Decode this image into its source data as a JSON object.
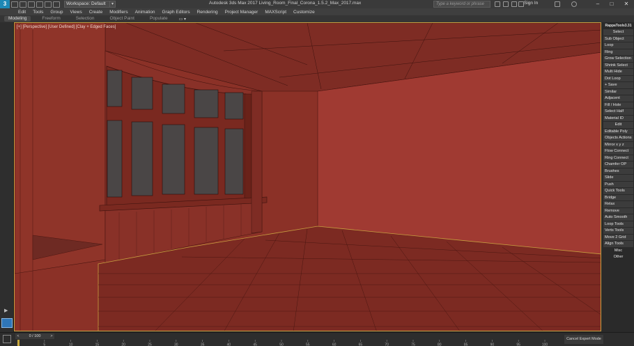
{
  "titlebar": {
    "logo": "3",
    "workspace": "Workspace: Default",
    "title": "Autodesk 3ds Max 2017    Living_Room_Final_Corona_1.5.2_Max_2017.max",
    "search_placeholder": "Type a keyword or phrase",
    "signin": "Sign In",
    "minimize": "–",
    "maximize": "□",
    "close": "✕"
  },
  "menu": [
    "Edit",
    "Tools",
    "Group",
    "Views",
    "Create",
    "Modifiers",
    "Animation",
    "Graph Editors",
    "Rendering",
    "Project Manager",
    "MAXScript",
    "Customize"
  ],
  "ribbon": {
    "tabs": [
      {
        "label": "Modeling",
        "active": true
      },
      {
        "label": "Freeform",
        "active": false
      },
      {
        "label": "Selection",
        "active": false
      },
      {
        "label": "Object Paint",
        "active": false
      },
      {
        "label": "Populate",
        "active": false
      }
    ],
    "pin": "▭ ▾"
  },
  "viewport": {
    "label": "[+] [Perspective] [User Defined] [Clay + Edged Faces]",
    "scene_color": "#8b3127",
    "selection_color": "#c8a040"
  },
  "rappatools": {
    "title": "RappaTools3.31",
    "select_header": "Select",
    "select_items": [
      "Sub Object",
      "Loop",
      "Ring",
      "Grow Selection",
      "Shrink Select",
      "Multi Hide",
      "Dot Loop",
      "+ Save",
      "Similar",
      "Adjacent",
      "Fill / Hole",
      "Select Half",
      "Material ID"
    ],
    "edit_header": "Edit",
    "edit_items": [
      "Editable Poly",
      "Objects Actions",
      "Mirror   x  y  z",
      "Flow Connect",
      "Ring Connect",
      "Chamfer OP",
      "Brushes",
      "Slide",
      "Push",
      "Quick Tools",
      "Bridge",
      "Relax",
      "Remove",
      "Auto Smooth",
      "Loop Tools",
      "Verts Tools",
      "Move 2 Grid",
      "Align Tools"
    ],
    "misc_header": "Misc",
    "other_header": "Other"
  },
  "bottom": {
    "frame_counter": "0 / 100",
    "prev": "<",
    "next": ">",
    "ticks": [
      "0",
      "5",
      "10",
      "15",
      "20",
      "25",
      "30",
      "35",
      "40",
      "45",
      "50",
      "55",
      "60",
      "65",
      "70",
      "75",
      "80",
      "85",
      "90",
      "95",
      "100"
    ],
    "cancel_expert": "Cancel Expert Mode"
  },
  "left": {
    "play": "▶"
  }
}
